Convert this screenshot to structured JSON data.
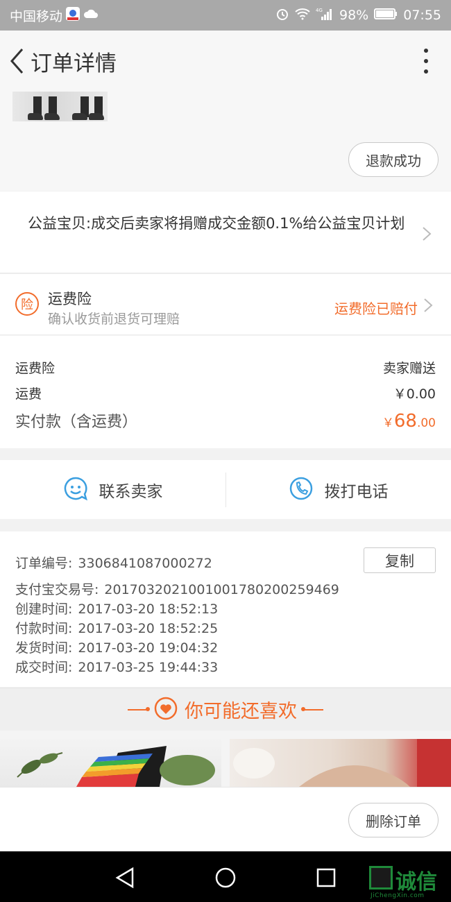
{
  "status_bar": {
    "carrier": "中国移动",
    "battery": "98%",
    "time": "07:55",
    "network": "4G"
  },
  "header": {
    "title": "订单详情"
  },
  "product": {
    "refund_status": "退款成功"
  },
  "charity": {
    "text": "公益宝贝:成交后卖家将捐赠成交金额0.1%给公益宝贝计划"
  },
  "insurance": {
    "icon_char": "险",
    "title": "运费险",
    "subtitle": "确认收货前退货可理赔",
    "status": "运费险已赔付"
  },
  "fees": {
    "insurance_label": "运费险",
    "insurance_value": "卖家赠送",
    "shipping_label": "运费",
    "shipping_value": "￥0.00",
    "paid_label": "实付款（含运费）",
    "paid_currency": "￥",
    "paid_int": "68",
    "paid_dec": ".00"
  },
  "contact": {
    "seller_label": "联系卖家",
    "call_label": "拨打电话"
  },
  "order_info": {
    "order_no_label": "订单编号:",
    "order_no": "3306841087000272",
    "copy_label": "复制",
    "alipay_label": "支付宝交易号:",
    "alipay_no": "2017032021001001780200259469",
    "created_label": "创建时间:",
    "created": "2017-03-20 18:52:13",
    "paid_label": "付款时间:",
    "paid": "2017-03-20 18:52:25",
    "shipped_label": "发货时间:",
    "shipped": "2017-03-20 19:04:32",
    "completed_label": "成交时间:",
    "completed": "2017-03-25 19:44:33"
  },
  "recommend": {
    "title": "你可能还喜欢"
  },
  "bottom": {
    "delete_label": "删除订单"
  },
  "watermark": {
    "text": "诚信",
    "sub": "JiChengXin.com"
  },
  "colors": {
    "accent": "#f26c2b",
    "contact_blue": "#3b9fe0",
    "status_bar": "#a9a9a9"
  }
}
